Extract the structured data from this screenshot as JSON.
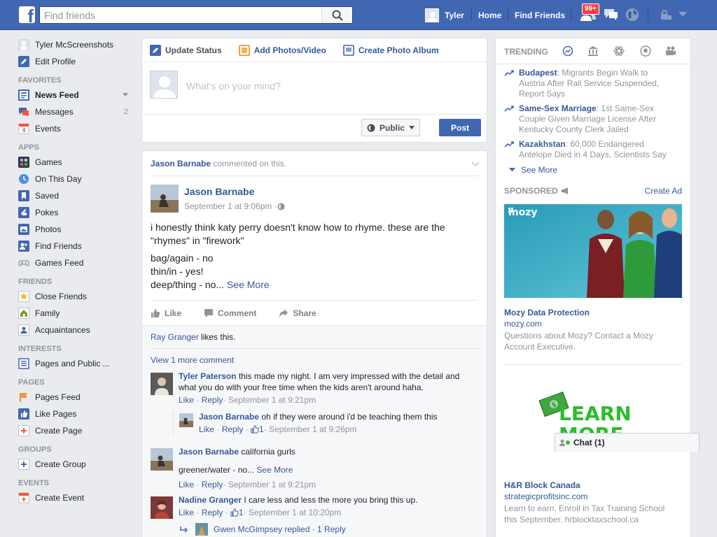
{
  "topbar": {
    "logo": "f",
    "search_placeholder": "Find friends",
    "user": "Tyler",
    "home": "Home",
    "find_friends": "Find Friends",
    "notif_count": "99+"
  },
  "left_nav": {
    "profile_name": "Tyler McScreenshots",
    "edit_profile": "Edit Profile",
    "favorites_head": "FAVORITES",
    "news_feed": "News Feed",
    "messages": "Messages",
    "messages_count": "2",
    "events": "Events",
    "apps_head": "APPS",
    "games": "Games",
    "on_this_day": "On This Day",
    "saved": "Saved",
    "pokes": "Pokes",
    "photos": "Photos",
    "find_friends": "Find Friends",
    "games_feed": "Games Feed",
    "friends_head": "FRIENDS",
    "close_friends": "Close Friends",
    "family": "Family",
    "acquaintances": "Acquaintances",
    "interests_head": "INTERESTS",
    "pages_public": "Pages and Public ...",
    "pages_head": "PAGES",
    "pages_feed": "Pages Feed",
    "like_pages": "Like Pages",
    "create_page": "Create Page",
    "groups_head": "GROUPS",
    "create_group": "Create Group",
    "events_head": "EVENTS",
    "create_event": "Create Event"
  },
  "composer": {
    "tab_update": "Update Status",
    "tab_photos": "Add Photos/Video",
    "tab_album": "Create Photo Album",
    "placeholder": "What's on your mind?",
    "privacy": "Public",
    "post": "Post"
  },
  "story": {
    "context_name": "Jason Barnabe",
    "context_text": " commented on this.",
    "author": "Jason Barnabe",
    "time": "September 1 at 9:06pm · ",
    "text_line1": "i honestly think katy perry doesn't know how to rhyme. these are the \"rhymes\" in \"firework\"",
    "text_line2": "bag/again - no",
    "text_line3": "thin/in - yes!",
    "text_line4": "deep/thing - no... ",
    "see_more": "See More",
    "like": "Like",
    "comment": "Comment",
    "share": "Share",
    "likes_name": "Ray Granger",
    "likes_text": " likes this.",
    "view_more": "View 1 more comment",
    "comments": [
      {
        "name": "Tyler Paterson",
        "text": " this made my night. I am very impressed with the detail and what you do with your free time when the kids aren't around haha.",
        "like": "Like",
        "reply": "Reply",
        "time": " · September 1 at 9:21pm"
      },
      {
        "name": "Jason Barnabe",
        "text": " oh if they were around i'd be teaching them this",
        "like": "Like",
        "reply": "Reply",
        "likes": "1",
        "time": " · September 1 at 9:26pm"
      },
      {
        "name": "Jason Barnabe",
        "text": " california gurls",
        "text2": "greener/water - no... ",
        "see_more": "See More",
        "like": "Like",
        "reply": "Reply",
        "time": " · September 1 at 9:21pm"
      },
      {
        "name": "Nadine Granger",
        "text": " I care less and less the more you bring this up.",
        "like": "Like",
        "reply": "Reply",
        "likes": "1",
        "time": " · September 1 at 10:20pm"
      }
    ],
    "replied_line": "Gwen McGimpsey replied · 1 Reply"
  },
  "right": {
    "trending_head": "TRENDING",
    "trends": [
      {
        "topic": "Budapest",
        "text": ": Migrants Begin Walk to Austria After Rail Service Suspended, Report Says"
      },
      {
        "topic": "Same-Sex Marriage",
        "text": ": 1st Same-Sex Couple Given Marriage License After Kentucky County Clerk Jailed"
      },
      {
        "topic": "Kazakhstan",
        "text": ": 60,000 Endangered Antelope Died in 4 Days, Scientists Say"
      }
    ],
    "see_more": "See More",
    "sponsored_head": "SPONSORED",
    "create_ad": "Create Ad",
    "ad1_brand": "mozy",
    "ad1_title": "Mozy Data Protection",
    "ad1_url": "mozy.com",
    "ad1_desc": "Questions about Mozy? Contact a Mozy Account Executive.",
    "ad2_image_text1": "LEARN",
    "ad2_image_text2": "MORE",
    "ad2_title": "H&R Block Canada",
    "ad2_url": "strategicprofitsinc.com",
    "ad2_desc": "Learn to earn. Enroll in Tax Training School this September. hrblocktaxschool.ca"
  },
  "chat": {
    "label": "Chat (1)"
  }
}
